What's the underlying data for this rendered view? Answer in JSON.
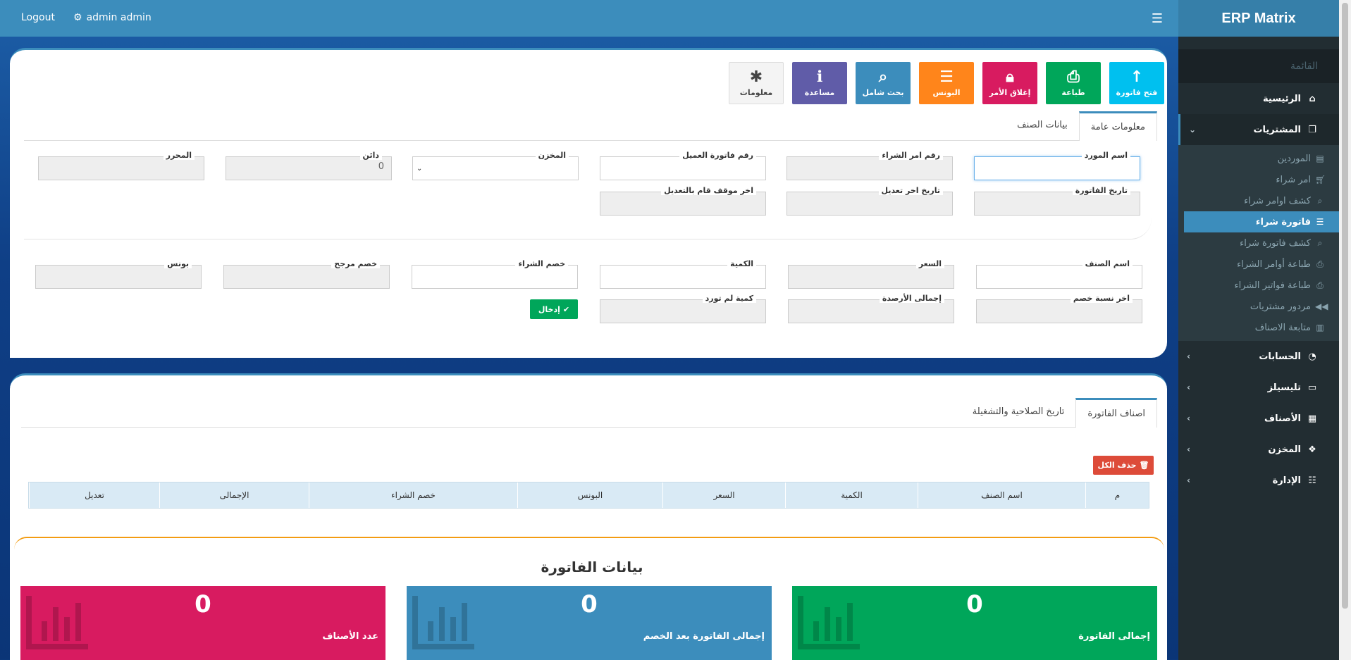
{
  "topbar": {
    "logout": "Logout",
    "user": "admin admin"
  },
  "sidebar": {
    "brand": "ERP Matrix",
    "menu_header": "القائمة",
    "home": "الرئيسية",
    "purchases": "المشتريات",
    "purchase_items": [
      {
        "label": "الموردين",
        "icon": "id-card-icon"
      },
      {
        "label": "امر شراء",
        "icon": "cart-icon"
      },
      {
        "label": "كشف اوامر شراء",
        "icon": "search-icon"
      },
      {
        "label": "فاتورة شراء",
        "icon": "list-icon"
      },
      {
        "label": "كشف فاتورة شراء",
        "icon": "search-icon"
      },
      {
        "label": "طباعة أوامر الشراء",
        "icon": "print-icon"
      },
      {
        "label": "طباعة فواتير الشراء",
        "icon": "print-icon"
      },
      {
        "label": "مردور مشتريات",
        "icon": "backward-icon"
      },
      {
        "label": "متابعة الاصناف",
        "icon": "chart-icon"
      }
    ],
    "accounts": "الحسابات",
    "telesales": "تليسيلز",
    "items": "الأصناف",
    "warehouse": "المخزن",
    "admin": "الإدارة"
  },
  "toolbar": {
    "open_invoice": "فتح فاتورة",
    "print": "طباعة",
    "close_order": "إغلاق الأمر",
    "bonus": "البونس",
    "full_search": "بحث شامل",
    "help": "مساعدة",
    "info": "معلومات"
  },
  "tabs1": {
    "general": "معلومات عامة",
    "item_data": "بيانات الصنف"
  },
  "form": {
    "supplier_name": "اسم المورد",
    "po_number": "رقم امر الشراء",
    "client_invoice_number": "رقم فاتورة العميل",
    "warehouse": "المخزن",
    "creditor": "دائن",
    "creditor_value": "0",
    "editor": "المحرر",
    "invoice_date": "تاريخ الفاتورة",
    "last_edit_date": "تاريخ اخر تعديل",
    "last_editor": "اخر موقف قام بالتعديل",
    "item_name": "اسم الصنف",
    "price": "السعر",
    "quantity": "الكمية",
    "purchase_discount": "خصم الشراء",
    "weighted_discount": "خصم مرجح",
    "bonus": "بونس",
    "last_discount_pct": "اخر نسبة خصم",
    "total_balances": "إجمالى الأرصدة",
    "qty_not_supplied": "كمية لم تورد",
    "enter_button": "إدخال"
  },
  "tabs2": {
    "invoice_items": "اصناف الفاتورة",
    "expiry": "تاريخ الصلاحية والتشغيلة"
  },
  "table": {
    "delete_all": "حذف الكل",
    "headers": [
      "م",
      "اسم الصنف",
      "الكمية",
      "السعر",
      "البونس",
      "خصم الشراء",
      "الإجمالى",
      "تعديل"
    ]
  },
  "summary": {
    "title": "بيانات الفاتورة",
    "cards": [
      {
        "value": "0",
        "label": "إجمالى الفاتورة",
        "color": "#00a65a"
      },
      {
        "value": "0",
        "label": "إجمالى الفاتورة بعد الخصم",
        "color": "#3c8dbc"
      },
      {
        "value": "0",
        "label": "عدد الأصناف",
        "color": "#d81b60"
      }
    ]
  },
  "colors": {
    "green": "#00a65a",
    "teal": "#00c0ef",
    "red": "#dd4b39",
    "orange": "#ff851b",
    "blue": "#3c8dbc",
    "purple": "#605ca8",
    "gray": "#eeeeee"
  }
}
